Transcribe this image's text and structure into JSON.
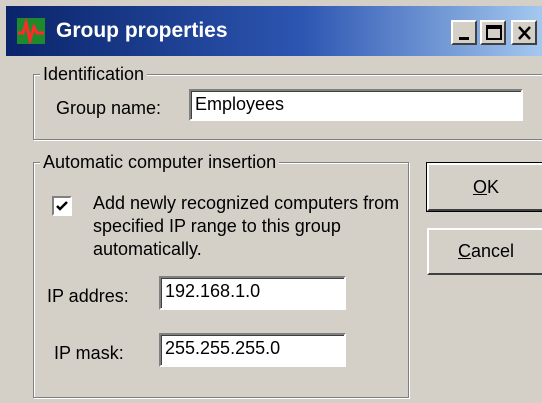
{
  "window": {
    "title": "Group properties",
    "controls": [
      "minimize-icon",
      "maximize-icon",
      "close-icon"
    ]
  },
  "identification": {
    "legend": "Identification",
    "group_name_label": "Group name:",
    "group_name_value": "Employees"
  },
  "auto_insertion": {
    "legend": "Automatic computer insertion",
    "checkbox_checked": true,
    "checkbox_label": "Add newly recognized computers from specified IP range to this group automatically.",
    "ip_address_label": "IP addres:",
    "ip_address_value": "192.168.1.0",
    "ip_mask_label": "IP mask:",
    "ip_mask_value": "255.255.255.0"
  },
  "buttons": {
    "ok_mnemonic": "O",
    "ok_rest": "K",
    "cancel_mnemonic": "C",
    "cancel_rest": "ancel"
  },
  "colors": {
    "titlebar_start": "#0a246a",
    "titlebar_end": "#a6caf0",
    "face": "#d4d0c8"
  }
}
